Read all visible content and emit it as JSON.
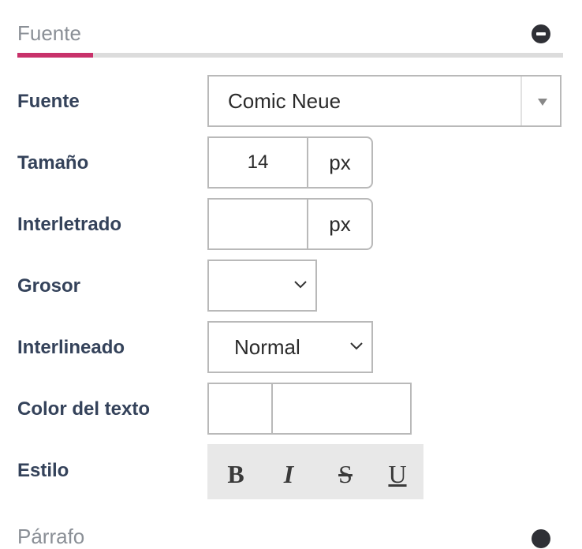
{
  "section": {
    "title": "Fuente"
  },
  "fields": {
    "font": {
      "label": "Fuente",
      "value": "Comic Neue"
    },
    "size": {
      "label": "Tamaño",
      "value": "14",
      "unit": "px"
    },
    "letter_spacing": {
      "label": "Interletrado",
      "value": "",
      "unit": "px"
    },
    "weight": {
      "label": "Grosor",
      "value": ""
    },
    "line_height": {
      "label": "Interlineado",
      "value": "Normal"
    },
    "text_color": {
      "label": "Color del texto",
      "value": ""
    },
    "style": {
      "label": "Estilo",
      "bold": "B",
      "italic": "I",
      "strike": "S",
      "underline": "U"
    }
  },
  "next_section": {
    "title": "Párrafo"
  },
  "colors": {
    "accent": "#c8316a",
    "label": "#34425a"
  }
}
